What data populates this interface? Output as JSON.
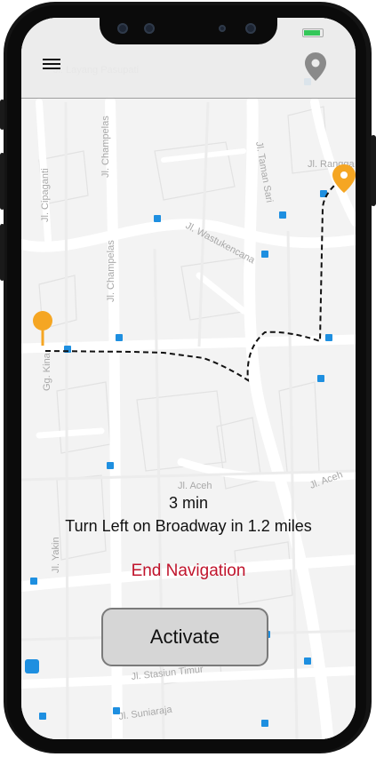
{
  "header": {
    "menu_icon": "hamburger-menu-icon",
    "location_icon": "map-pin-icon",
    "status_battery_color": "#34c759"
  },
  "map": {
    "street_labels": [
      "Jl. Layang Pasupati",
      "Jl. Champelas",
      "Jl. Cipaganti",
      "Jl. Wastukencana",
      "Jl. Taman Sari",
      "Jl. Rangga",
      "Jl. Aceh",
      "Jl. Yakin",
      "Jl. Stasiun Timur",
      "Jl. Suniaraja",
      "Gg. Kina"
    ],
    "origin_marker_color": "#f5a623",
    "destination_marker_color": "#f5a623",
    "route_style": "dashed-black"
  },
  "navigation": {
    "eta": "3 min",
    "instruction": "Turn Left on Broadway in 1.2 miles",
    "end_label": "End Navigation",
    "end_color": "#c0142c"
  },
  "actions": {
    "activate_label": "Activate"
  }
}
